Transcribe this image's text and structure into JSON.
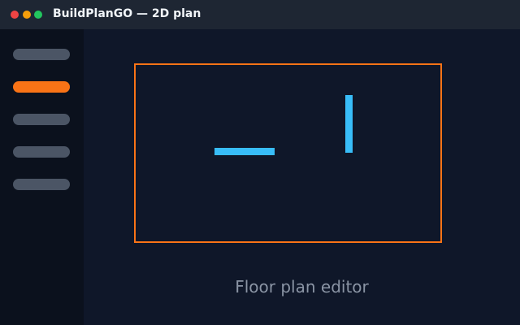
{
  "window": {
    "title": "BuildPlanGO — 2D plan"
  },
  "sidebar": {
    "items": [
      {
        "state": "inactive"
      },
      {
        "state": "active"
      },
      {
        "state": "inactive"
      },
      {
        "state": "inactive"
      },
      {
        "state": "inactive"
      }
    ]
  },
  "editor": {
    "caption": "Floor plan editor"
  },
  "colors": {
    "accent": "#f97316",
    "wall": "#38bdf8",
    "background": "#0f1729",
    "titlebar": "#1e2633",
    "sidebar": "#0b111d",
    "inactive_item": "#4b5565",
    "traffic_red": "#ef4444",
    "traffic_yellow": "#f59e0b",
    "traffic_green": "#22c55e"
  }
}
